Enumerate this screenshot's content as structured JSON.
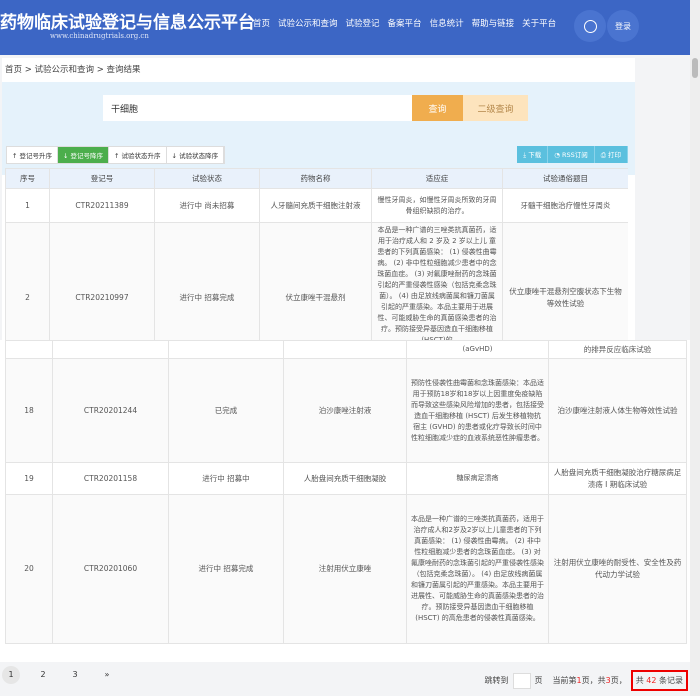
{
  "header": {
    "title": "药物临床试验登记与信息公示平台",
    "url": "www.chinadrugtrials.org.cn",
    "nav": [
      "首页",
      "试验公示和查询",
      "试验登记",
      "备案平台",
      "信息统计",
      "帮助与链接",
      "关于平台"
    ],
    "login": "登录"
  },
  "breadcrumb": "首页 > 试验公示和查询 > 查询结果",
  "search": {
    "value": "干细胞",
    "query_btn": "查询",
    "advanced_btn": "二级查询"
  },
  "toolbar": {
    "sort": [
      "登记号升序",
      "登记号降序",
      "试验状态升序",
      "试验状态降序"
    ],
    "actions": [
      "下载",
      "RSS订阅",
      "打印"
    ]
  },
  "table": {
    "headers": [
      "序号",
      "登记号",
      "试验状态",
      "药物名称",
      "适应症",
      "试验通俗题目"
    ],
    "rows_top": [
      {
        "no": "1",
        "id": "CTR20211389",
        "status": "进行中 尚未招募",
        "drug": "人牙髓间充质干细胞注射液",
        "indication": "慢性牙周炎，如慢性牙周炎所致的牙周骨组织缺损的治疗。",
        "title": "牙髓干细胞治疗慢性牙周炎"
      },
      {
        "no": "2",
        "id": "CTR20210997",
        "status": "进行中 招募完成",
        "drug": "伏立康唑干混悬剂",
        "indication": "本品是一种广谱的三唑类抗真菌药，适用于治疗成人和 2 岁及 2 岁以上儿 童患者的下列真菌感染： (1) 侵袭性曲霉病。 (2) 非中性粒细胞减少患者中的念珠菌血症。 (3) 对氟康唑耐药的念珠菌引起的严重侵袭性感染（包括克柔念珠菌）。 (4) 由足放线病菌属和镰刀菌属引起的严重感染。本品主要用于进展性、可能威胁生命的真菌感染患者的治疗。预防接受异基因造血干细胞移植(HSCT)的",
        "title": "伏立康唑干混悬剂空腹状态下生物等效性试验"
      }
    ],
    "partial_row": {
      "indication": "(aGvHD)",
      "title": "的排异反应临床试验"
    },
    "rows_bottom": [
      {
        "no": "18",
        "id": "CTR20201244",
        "status": "已完成",
        "drug": "泊沙康唑注射液",
        "indication": "预防性侵袭性曲霉菌和念珠菌感染：本品适用于预防18岁和18岁以上因重度免疫缺陷而导致这些感染风险增加的患者，包括接受造血干细胞移植 (HSCT) 后发生移植物抗宿主 (GVHD) 的患者或化疗导致长时间中性粒细胞减少症的血液系统恶性肿瘤患者。",
        "title": "泊沙康唑注射液人体生物等效性试验"
      },
      {
        "no": "19",
        "id": "CTR20201158",
        "status": "进行中 招募中",
        "drug": "人胎盘间充质干细胞凝胶",
        "indication": "糖尿病足溃疡",
        "title": "人胎盘间充质干细胞凝胶治疗糖尿病足溃疡 I 期临床试验"
      },
      {
        "no": "20",
        "id": "CTR20201060",
        "status": "进行中 招募完成",
        "drug": "注射用伏立康唑",
        "indication": "本品是一种广谱的三唑类抗真菌药，适用于治疗成人和2岁及2岁以上儿童患者的下列真菌感染： (1) 侵袭性曲霉病。 (2) 非中性粒细胞减少患者的念珠菌血症。 (3) 对氟康唑耐药的念珠菌引起的严重侵袭性感染（包括克柔念珠菌）。 (4) 由足放线病菌属和镰刀菌属引起的严重感染。本品主要用于进展性、可能威胁生命的真菌感染患者的治疗。预防接受异基因造血干细胞移植 (HSCT) 的高危患者的侵袭性真菌感染。",
        "title": "注射用伏立康唑的耐受性、安全性及药代动力学试验"
      }
    ]
  },
  "pagination": {
    "pages": [
      "1",
      "2",
      "3"
    ],
    "next": "»",
    "jump_label": "跳转到",
    "page_unit": "页",
    "current_prefix": "当前第",
    "current": "1",
    "current_suffix": "页，共",
    "total_pages": "3",
    "pages_suffix": "页，",
    "total_prefix": "共",
    "total_records": "42",
    "total_suffix": "条记录"
  }
}
